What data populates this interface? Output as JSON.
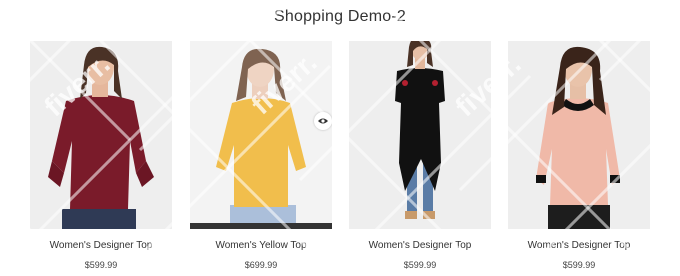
{
  "page": {
    "title": "Shopping Demo-2"
  },
  "products": [
    {
      "name": "Women's Designer Top",
      "price": "$599.99",
      "image": "woman-maroon-lace-top-photo"
    },
    {
      "name": "Women's Yellow Top",
      "price": "$699.99",
      "image": "woman-yellow-top-photo"
    },
    {
      "name": "Women's Designer Top",
      "price": "$599.99",
      "image": "woman-black-sheer-tunic-photo"
    },
    {
      "name": "Women's Designer Top",
      "price": "$599.99",
      "image": "woman-peach-collared-top-photo"
    }
  ],
  "icons": {
    "quick_view": "eye-icon"
  },
  "watermark": {
    "text": "fiverr."
  },
  "colors": {
    "background": "#ffffff",
    "text": "#333333",
    "photo_bg": "#eeeeee",
    "hover_bar": "#333333"
  }
}
